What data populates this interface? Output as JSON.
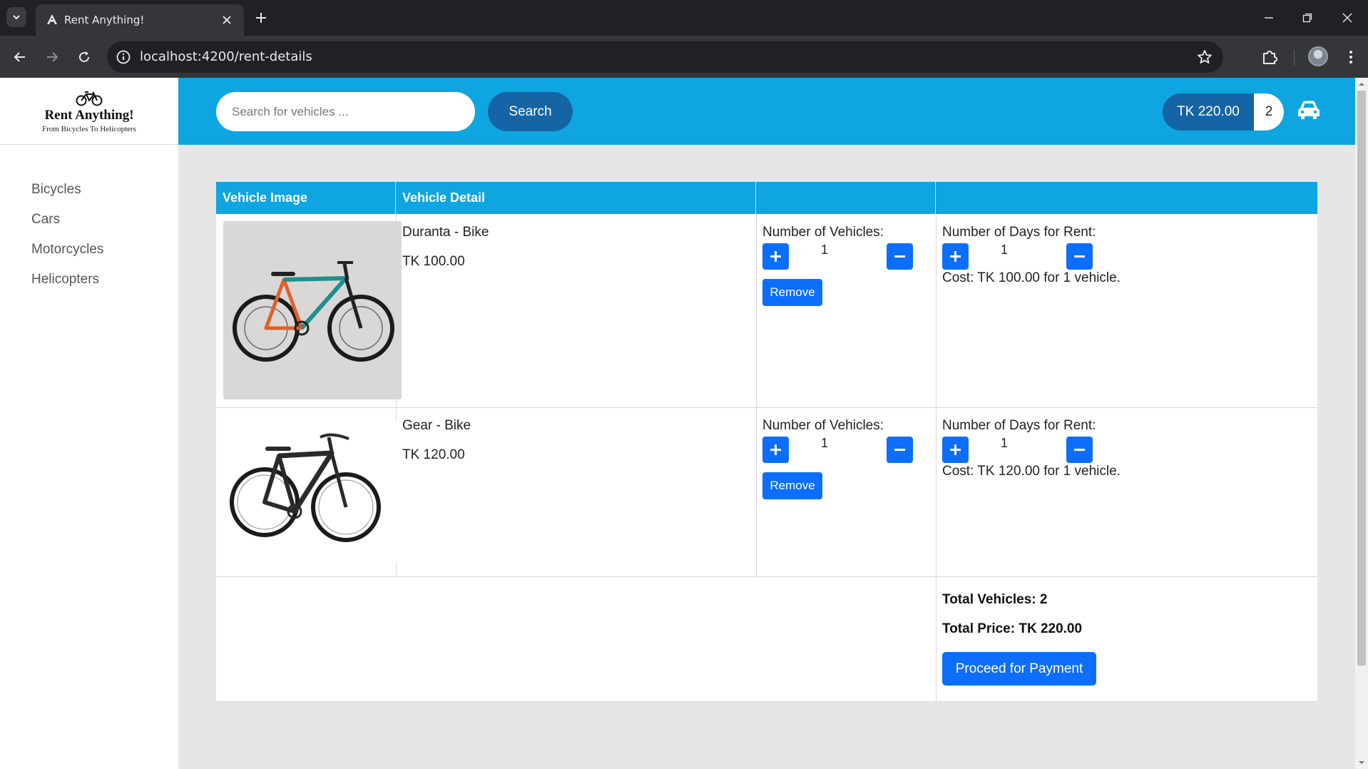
{
  "browser": {
    "tab_title": "Rent Anything!",
    "url": "localhost:4200/rent-details"
  },
  "brand": {
    "title": "Rent Anything!",
    "subtitle": "From Bicycles To Helicopters"
  },
  "sidebar": {
    "items": [
      {
        "label": "Bicycles"
      },
      {
        "label": "Cars"
      },
      {
        "label": "Motorcycles"
      },
      {
        "label": "Helicopters"
      }
    ]
  },
  "header": {
    "search_placeholder": "Search for vehicles ...",
    "search_button": "Search",
    "cart_total": "TK 220.00",
    "cart_count": "2"
  },
  "table": {
    "headers": [
      "Vehicle Image",
      "Vehicle Detail",
      "",
      ""
    ],
    "rows": [
      {
        "name": "Duranta - Bike",
        "price": "TK 100.00",
        "vehicles_label": "Number of Vehicles:",
        "vehicles": "1",
        "remove_label": "Remove",
        "days_label": "Number of Days for Rent:",
        "days": "1",
        "cost": "Cost: TK 100.00 for 1 vehicle.",
        "image": "bicycle-photo-duranta"
      },
      {
        "name": "Gear - Bike",
        "price": "TK 120.00",
        "vehicles_label": "Number of Vehicles:",
        "vehicles": "1",
        "remove_label": "Remove",
        "days_label": "Number of Days for Rent:",
        "days": "1",
        "cost": "Cost: TK 120.00 for 1 vehicle.",
        "image": "bicycle-photo-gear"
      }
    ],
    "summary": {
      "total_vehicles": "Total Vehicles: 2",
      "total_price": "Total Price: TK 220.00",
      "pay_button": "Proceed for Payment"
    }
  },
  "colors": {
    "accent": "#0ea5e0",
    "primary_button": "#0d6efd",
    "dark_pill": "#1565a6"
  }
}
